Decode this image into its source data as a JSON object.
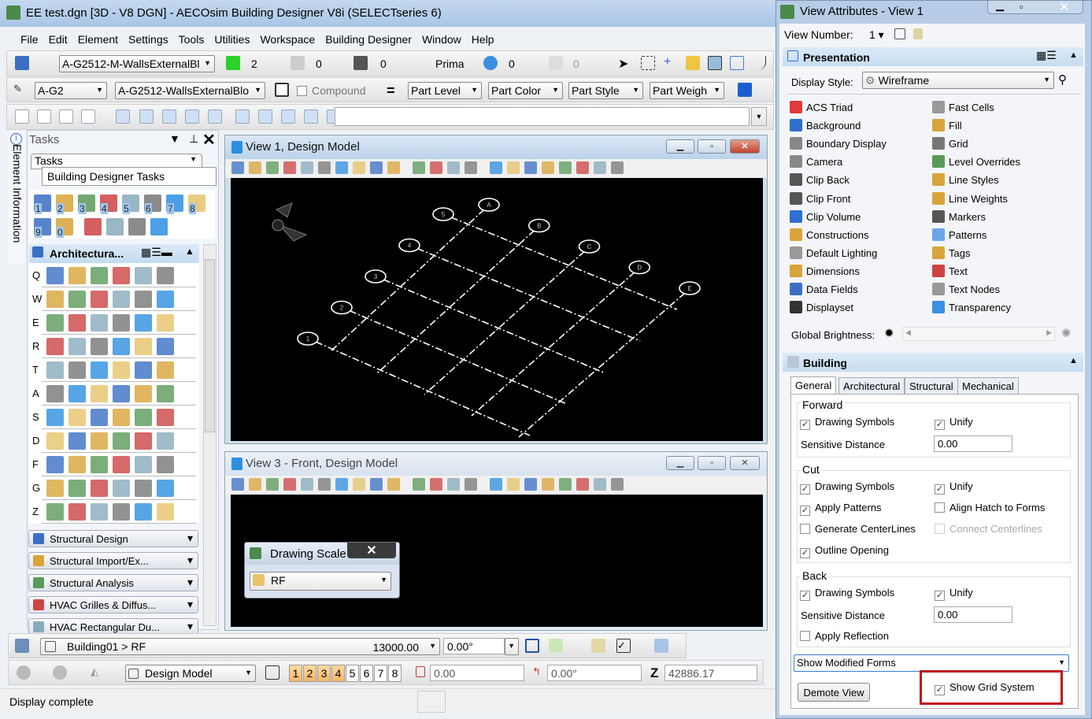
{
  "app": {
    "title": "EE test.dgn [3D - V8 DGN] - AECOsim Building Designer V8i (SELECTseries 6)"
  },
  "menu": [
    "File",
    "Edit",
    "Element",
    "Settings",
    "Tools",
    "Utilities",
    "Workspace",
    "Building Designer",
    "Window",
    "Help"
  ],
  "toolbar1": {
    "level": "A-G2512-M-WallsExternalBl",
    "color": "2",
    "style": "0",
    "weight": "0",
    "class": "Prima",
    "transparency": "0",
    "priority": "0"
  },
  "toolbar2": {
    "level": "A-G2",
    "part": "A-G2512-WallsExternalBlo",
    "compound": "Compound",
    "part_level": "Part Level",
    "part_color": "Part Color",
    "part_style": "Part Style",
    "part_weight": "Part Weigh"
  },
  "tasks": {
    "title": "Tasks",
    "tab": "Tasks",
    "subtitle": "Building Designer Tasks",
    "side_tab": "Element Information",
    "quick_keys": [
      "1",
      "2",
      "3",
      "4",
      "5",
      "6",
      "7",
      "8",
      "9",
      "0"
    ],
    "section": "Architectura...",
    "row_keys": [
      "Q",
      "W",
      "E",
      "R",
      "T",
      "A",
      "S",
      "D",
      "F",
      "G",
      "Z"
    ],
    "groups": [
      "Structural Design",
      "Structural  Import/Ex...",
      "Structural Analysis",
      "HVAC Grilles  & Diffus...",
      "HVAC Rectangular Du..."
    ]
  },
  "view1": {
    "title": "View 1, Design Model",
    "grid_numbers": [
      "1",
      "2",
      "3",
      "4",
      "5"
    ],
    "grid_letters": [
      "A",
      "B",
      "C",
      "D",
      "E"
    ]
  },
  "view3": {
    "title": "View 3 - Front, Design Model"
  },
  "drawing_scale": {
    "title": "Drawing Scale",
    "value": "RF"
  },
  "bottom": {
    "floor": "Building01 > RF",
    "elevation": "13000.00",
    "angle": "0.00°",
    "model": "Design Model",
    "views": [
      "1",
      "2",
      "3",
      "4",
      "5",
      "6",
      "7",
      "8"
    ],
    "active_views": [
      "1",
      "2",
      "3",
      "4"
    ],
    "x": "0.00",
    "rot": "0.00°",
    "z_label": "Z",
    "z": "42886.17",
    "status": "Display complete"
  },
  "attributes": {
    "title": "View Attributes - View 1",
    "view_number_label": "View Number:",
    "view_number": "1",
    "presentation": "Presentation",
    "display_style_label": "Display Style:",
    "display_style": "Wireframe",
    "left_items": [
      "ACS Triad",
      "Background",
      "Boundary Display",
      "Camera",
      "Clip Back",
      "Clip Front",
      "Clip Volume",
      "Constructions",
      "Default Lighting",
      "Dimensions",
      "Data Fields",
      "Displayset"
    ],
    "right_items": [
      "Fast Cells",
      "Fill",
      "Grid",
      "Level Overrides",
      "Line Styles",
      "Line Weights",
      "Markers",
      "Patterns",
      "Tags",
      "Text",
      "Text Nodes",
      "Transparency"
    ],
    "brightness_label": "Global Brightness:",
    "building": "Building",
    "tabs": [
      "General",
      "Architectural",
      "Structural",
      "Mechanical"
    ],
    "active_tab": "General",
    "forward": {
      "label": "Forward",
      "drawing_symbols": "Drawing Symbols",
      "unify": "Unify",
      "sensitive_label": "Sensitive Distance",
      "sensitive": "0.00"
    },
    "cut": {
      "label": "Cut",
      "drawing_symbols": "Drawing Symbols",
      "unify": "Unify",
      "apply_patterns": "Apply Patterns",
      "align_hatch": "Align Hatch to Forms",
      "gen_centerlines": "Generate CenterLines",
      "connect_centerlines": "Connect Centerlines",
      "outline_opening": "Outline Opening"
    },
    "back": {
      "label": "Back",
      "drawing_symbols": "Drawing Symbols",
      "unify": "Unify",
      "sensitive_label": "Sensitive Distance",
      "sensitive": "0.00",
      "apply_reflection": "Apply Reflection"
    },
    "show_forms": "Show Modified Forms",
    "demote": "Demote View",
    "show_grid": "Show Grid System"
  },
  "colors": {
    "highlight": "#c0141c",
    "viewport": "#000000",
    "accent": "#f7b766"
  }
}
